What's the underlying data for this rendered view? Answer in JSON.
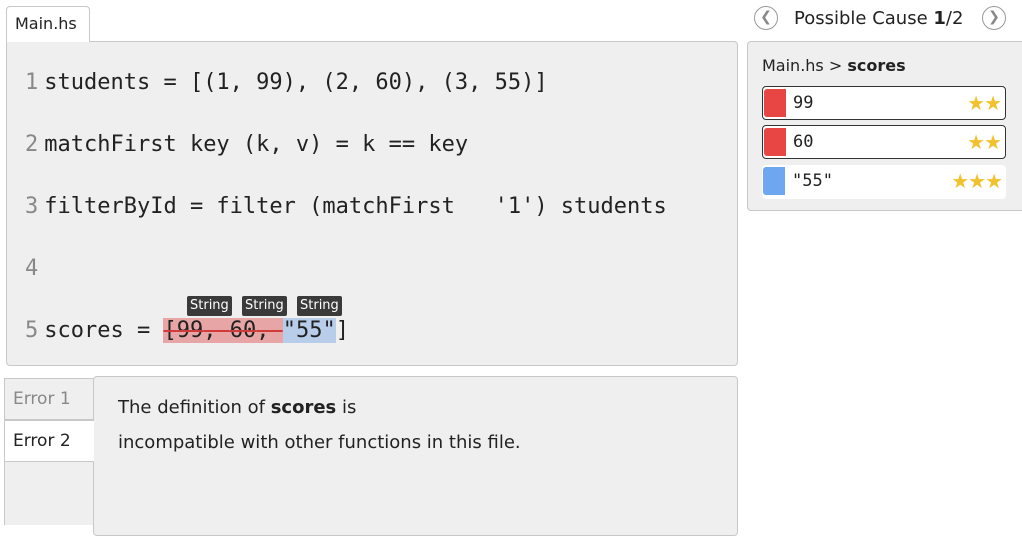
{
  "file_tab": "Main.hs",
  "code": {
    "lines": [
      {
        "num": "1",
        "text": "students = [(1, 99), (2, 60), (3, 55)]"
      },
      {
        "num": "2",
        "text": "matchFirst key (k, v) = k == key"
      },
      {
        "num": "3",
        "text": "filterById = filter (matchFirst   '1') students"
      },
      {
        "num": "4",
        "text": ""
      },
      {
        "num": "5",
        "prefix": "scores = ",
        "open": "[",
        "v1": "99",
        "sep1": ", ",
        "v2": "60",
        "sep2": ", ",
        "v3": "\"55\"",
        "close": "]"
      }
    ],
    "type_tags": [
      "String",
      "String",
      "String"
    ]
  },
  "errors": {
    "tabs": [
      "Error 1",
      "Error 2"
    ],
    "active": "Error 2",
    "message_line1_pre": "The definition of ",
    "message_bold": "scores",
    "message_line1_post": " is",
    "message_line2": "incompatible with other functions in this file."
  },
  "cause_nav": {
    "label": "Possible Cause ",
    "current": "1",
    "total": "/2",
    "prev_icon": "chevron-left-icon",
    "next_icon": "chevron-right-icon"
  },
  "cause_panel": {
    "crumb_file": "Main.hs > ",
    "crumb_symbol": "scores",
    "rows": [
      {
        "value": "99",
        "color": "#e84545",
        "stars": "★★",
        "rating": 2
      },
      {
        "value": "60",
        "color": "#e84545",
        "stars": "★★",
        "rating": 2
      },
      {
        "value": "\"55\"",
        "color": "#6ea6f0",
        "stars": "★★★",
        "rating": 3
      }
    ]
  }
}
